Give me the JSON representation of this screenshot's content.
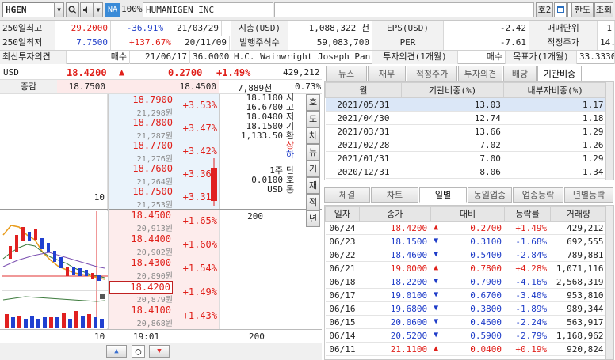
{
  "toolbar": {
    "symbol": "HGEN",
    "exchange_badge": "NA",
    "zoom": "100%",
    "company": "HUMANIGEN INC",
    "right_buttons": [
      "호2",
      "한도",
      "조회"
    ]
  },
  "info": {
    "rows": [
      [
        {
          "t": "250일최고",
          "k": "lbl"
        },
        {
          "t": "29.2000",
          "k": "red"
        },
        {
          "t": "-36.91%",
          "k": "blue"
        },
        {
          "t": "21/03/29"
        },
        {
          "t": "시총(USD)",
          "k": "lbl"
        },
        {
          "t": "1,088,322 천"
        },
        {
          "t": "EPS(USD)",
          "k": "lbl"
        },
        {
          "t": "-2.42"
        },
        {
          "t": "매매단위",
          "k": "lbl"
        },
        {
          "t": "1"
        }
      ],
      [
        {
          "t": "250일최저",
          "k": "lbl"
        },
        {
          "t": "7.7500",
          "k": "blue"
        },
        {
          "t": "+137.67%",
          "k": "red"
        },
        {
          "t": "20/11/09"
        },
        {
          "t": "발행주식수",
          "k": "lbl"
        },
        {
          "t": "59,083,700"
        },
        {
          "t": "PER",
          "k": "lbl"
        },
        {
          "t": "-7.61"
        },
        {
          "t": "적정주가",
          "k": "lbl"
        },
        {
          "t": "14.050"
        }
      ],
      [
        {
          "t": "최신투자의견",
          "k": "lbl"
        },
        {
          "t": "매수"
        },
        {
          "t": "21/06/17"
        },
        {
          "t": "36.0000"
        },
        {
          "t": "H.C. Wainwright Joseph Pantgi"
        },
        {
          "t": "투자의견(1개월)",
          "k": "lbl"
        },
        {
          "t": "매수"
        },
        {
          "t": "목표가(1개월)",
          "k": "lbl"
        },
        {
          "t": "33.3330"
        }
      ]
    ]
  },
  "quote": {
    "currency": "USD",
    "price": "18.4200",
    "arrow": "▲",
    "change": "0.2700",
    "pct": "+1.49%",
    "volume": "429,212",
    "label2": "증감",
    "bid": "18.7500",
    "ask": "18.4500",
    "vol2": "7,889천",
    "pct2": "0.73%"
  },
  "orderbook": {
    "asks": [
      {
        "price": "18.7900",
        "won": "21,298원",
        "pct": "+3.53%"
      },
      {
        "price": "18.7800",
        "won": "21,287원",
        "pct": "+3.47%"
      },
      {
        "price": "18.7700",
        "won": "21,276원",
        "pct": "+3.42%"
      },
      {
        "price": "18.7600",
        "won": "21,264원",
        "pct": "+3.36%"
      },
      {
        "price": "18.7500",
        "won": "21,253원",
        "pct": "+3.31%",
        "qty": "10"
      }
    ],
    "bids": [
      {
        "price": "18.4500",
        "won": "20,913원",
        "pct": "+1.65%",
        "qty": "200"
      },
      {
        "price": "18.4400",
        "won": "20,902원",
        "pct": "+1.60%"
      },
      {
        "price": "18.4300",
        "won": "20,890원",
        "pct": "+1.54%"
      },
      {
        "price": "18.4200",
        "won": "20,879원",
        "pct": "+1.49%"
      },
      {
        "price": "18.4100",
        "won": "20,868원",
        "pct": "+1.43%"
      }
    ],
    "summary": {
      "vals": [
        "18.1100",
        "16.6700",
        "18.0400",
        "18.1500",
        "1,133.50"
      ],
      "labels": [
        "시",
        "고",
        "저",
        "기",
        "환"
      ],
      "side": [
        "상",
        "하"
      ],
      "unit_vals": [
        "1주",
        "0.0100",
        "USD"
      ],
      "unit_labels": [
        "단",
        "호",
        "통"
      ]
    },
    "vbuttons": [
      "호",
      "도",
      "차",
      "뉴",
      "기",
      "재",
      "적",
      "년"
    ],
    "footer": {
      "left_qty": "10",
      "time": "19:01",
      "right_qty": "200"
    }
  },
  "left_tabs": [
    "뉴스",
    "재무",
    "적정주가",
    "투자의견",
    "배당",
    "기관비중"
  ],
  "ownership": {
    "headers": [
      "월",
      "기관비중(%)",
      "내부자비중(%)"
    ],
    "rows": [
      [
        "2021/05/31",
        "13.03",
        "1.17"
      ],
      [
        "2021/04/30",
        "12.74",
        "1.18"
      ],
      [
        "2021/03/31",
        "13.66",
        "1.29"
      ],
      [
        "2021/02/28",
        "7.02",
        "1.26"
      ],
      [
        "2021/01/31",
        "7.00",
        "1.29"
      ],
      [
        "2020/12/31",
        "8.06",
        "1.34"
      ]
    ]
  },
  "bottom_tabs": [
    "체결",
    "차트",
    "일별",
    "동일업종",
    "업종등락",
    "년별등락"
  ],
  "daily": {
    "headers": [
      "일자",
      "종가",
      "대비",
      "등락률",
      "거래량"
    ],
    "rows": [
      {
        "d": "06/24",
        "close": "18.4200",
        "dir": "up",
        "diff": "0.2700",
        "pct": "+1.49%",
        "vol": "429,212"
      },
      {
        "d": "06/23",
        "close": "18.1500",
        "dir": "down",
        "diff": "0.3100",
        "pct": "-1.68%",
        "vol": "692,555"
      },
      {
        "d": "06/22",
        "close": "18.4600",
        "dir": "down",
        "diff": "0.5400",
        "pct": "-2.84%",
        "vol": "789,881"
      },
      {
        "d": "06/21",
        "close": "19.0000",
        "dir": "up",
        "diff": "0.7800",
        "pct": "+4.28%",
        "vol": "1,071,116"
      },
      {
        "d": "06/18",
        "close": "18.2200",
        "dir": "down",
        "diff": "0.7900",
        "pct": "-4.16%",
        "vol": "2,568,319"
      },
      {
        "d": "06/17",
        "close": "19.0100",
        "dir": "down",
        "diff": "0.6700",
        "pct": "-3.40%",
        "vol": "953,810"
      },
      {
        "d": "06/16",
        "close": "19.6800",
        "dir": "down",
        "diff": "0.3800",
        "pct": "-1.89%",
        "vol": "989,344"
      },
      {
        "d": "06/15",
        "close": "20.0600",
        "dir": "down",
        "diff": "0.4600",
        "pct": "-2.24%",
        "vol": "563,917"
      },
      {
        "d": "06/14",
        "close": "20.5200",
        "dir": "down",
        "diff": "0.5900",
        "pct": "-2.79%",
        "vol": "1,168,962"
      },
      {
        "d": "06/11",
        "close": "21.1100",
        "dir": "up",
        "diff": "0.0400",
        "pct": "+0.19%",
        "vol": "920,824"
      },
      {
        "d": "06/10",
        "close": "21.0700",
        "dir": "down",
        "diff": "0.5300",
        "pct": "-2.45%",
        "vol": "712,717"
      }
    ]
  }
}
